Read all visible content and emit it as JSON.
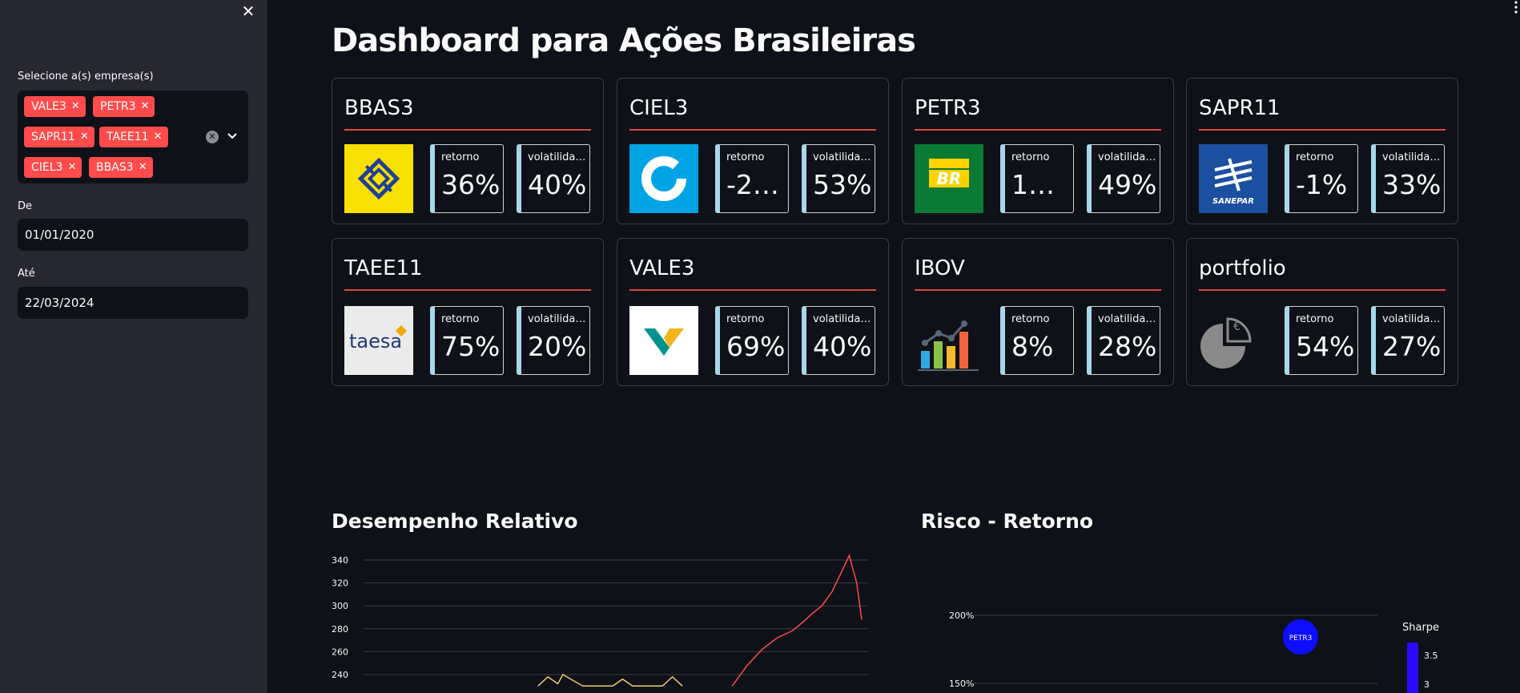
{
  "sidebar": {
    "close_icon": "close-icon",
    "select_label": "Selecione a(s) empresa(s)",
    "selected_tags": [
      "VALE3",
      "PETR3",
      "SAPR11",
      "TAEE11",
      "CIEL3",
      "BBAS3"
    ],
    "from_label": "De",
    "from_value": "01/01/2020",
    "to_label": "Até",
    "to_value": "22/03/2024"
  },
  "page": {
    "title": "Dashboard para Ações Brasileiras"
  },
  "cards": [
    {
      "ticker": "BBAS3",
      "logo": "bbas3-logo",
      "retorno_label": "retorno",
      "retorno": "36%",
      "vol_label": "volatilida…",
      "vol": "40%"
    },
    {
      "ticker": "CIEL3",
      "logo": "ciel3-logo",
      "retorno_label": "retorno",
      "retorno": "-2…",
      "vol_label": "volatilida…",
      "vol": "53%"
    },
    {
      "ticker": "PETR3",
      "logo": "petr3-logo",
      "retorno_label": "retorno",
      "retorno": "1…",
      "vol_label": "volatilida…",
      "vol": "49%"
    },
    {
      "ticker": "SAPR11",
      "logo": "sapr11-logo",
      "retorno_label": "retorno",
      "retorno": "-1%",
      "vol_label": "volatilida…",
      "vol": "33%"
    },
    {
      "ticker": "TAEE11",
      "logo": "taee11-logo",
      "retorno_label": "retorno",
      "retorno": "75%",
      "vol_label": "volatilida…",
      "vol": "20%"
    },
    {
      "ticker": "VALE3",
      "logo": "vale3-logo",
      "retorno_label": "retorno",
      "retorno": "69%",
      "vol_label": "volatilida…",
      "vol": "40%"
    },
    {
      "ticker": "IBOV",
      "logo": "ibov-chart-logo",
      "retorno_label": "retorno",
      "retorno": "8%",
      "vol_label": "volatilida…",
      "vol": "28%"
    },
    {
      "ticker": "portfolio",
      "logo": "portfolio-pie-logo",
      "retorno_label": "retorno",
      "retorno": "54%",
      "vol_label": "volatilida…",
      "vol": "27%"
    }
  ],
  "logo_texts": {
    "petr3": "BR",
    "sapr11": "SANEPAR",
    "taee11": "taesa",
    "portfolio": "€"
  },
  "sections": {
    "desempenho": "Desempenho Relativo",
    "risco": "Risco - Retorno"
  },
  "chart_data": [
    {
      "type": "line",
      "title": "Desempenho Relativo",
      "y_ticks": [
        "340",
        "320",
        "300",
        "280",
        "260",
        "240"
      ],
      "ylim": [
        230,
        345
      ],
      "grid": true,
      "series": [
        {
          "color": "#ff4b4b",
          "x": [
            0.74,
            0.77,
            0.8,
            0.83,
            0.86,
            0.88,
            0.9,
            0.92,
            0.94,
            0.96,
            0.975,
            0.99,
            1.0
          ],
          "values": [
            230,
            248,
            262,
            272,
            278,
            285,
            293,
            300,
            312,
            330,
            344,
            320,
            288
          ]
        },
        {
          "color": "#f5c96b",
          "x": [
            0.35,
            0.37,
            0.39,
            0.4,
            0.42,
            0.44,
            0.5,
            0.52,
            0.54,
            0.6,
            0.62,
            0.64
          ],
          "values": [
            230,
            238,
            232,
            240,
            235,
            230,
            230,
            236,
            230,
            230,
            238,
            230
          ]
        }
      ]
    },
    {
      "type": "scatter",
      "title": "Risco - Retorno",
      "y_ticks": [
        "200%",
        "150%"
      ],
      "grid": true,
      "legend_title": "Sharpe",
      "colorbar_ticks": [
        "3.5",
        "3"
      ],
      "points": [
        {
          "label": "PETR3",
          "color": "#0d0dff"
        }
      ]
    }
  ]
}
